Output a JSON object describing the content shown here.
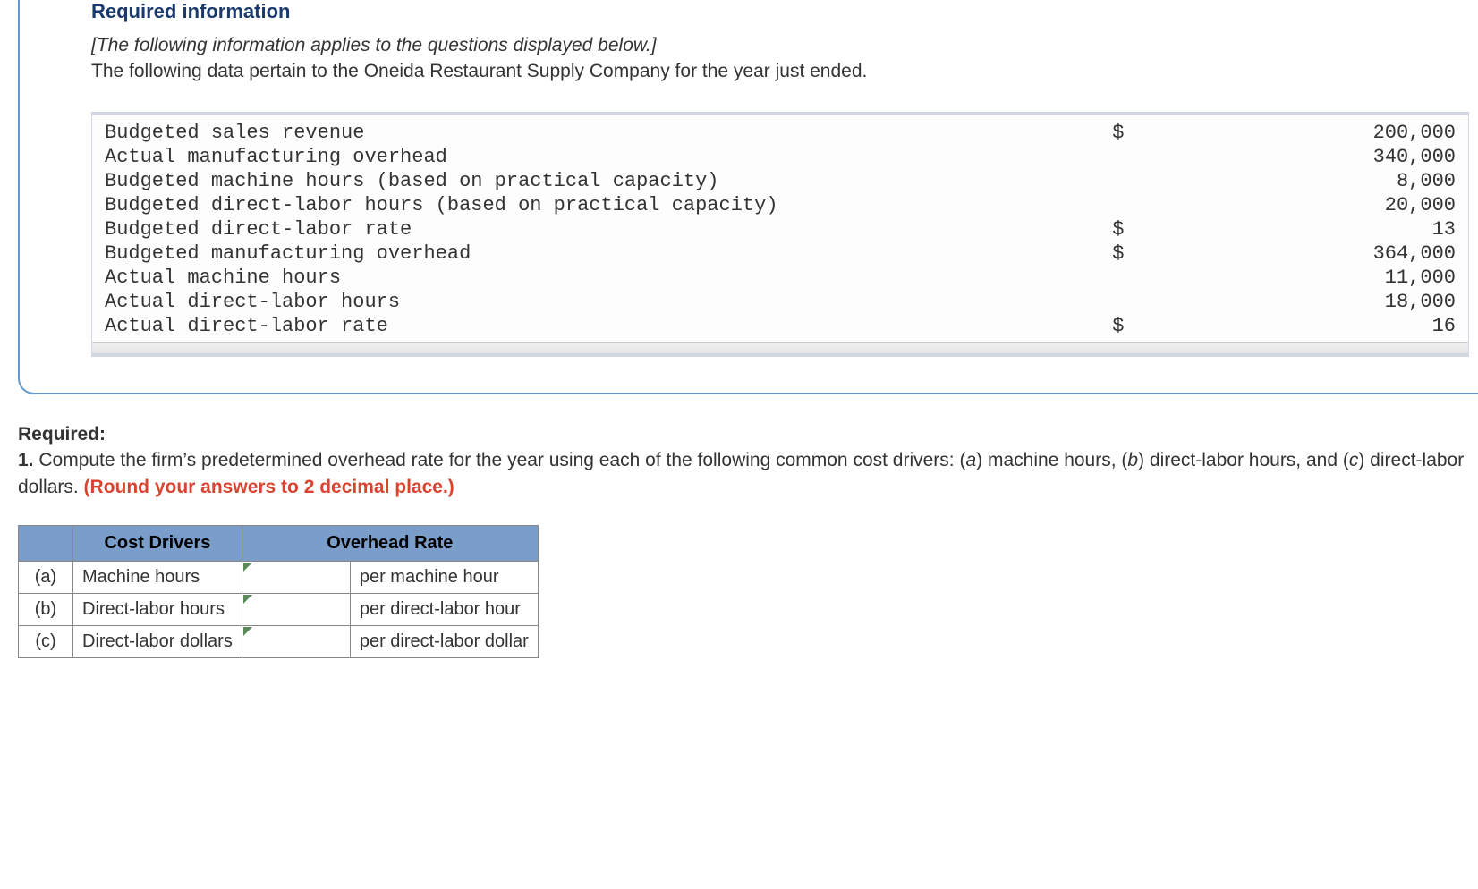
{
  "section_title": "Required information",
  "intro_italic": "[The following information applies to the questions displayed below.]",
  "intro_text": "The following data pertain to the Oneida Restaurant Supply Company for the year just ended.",
  "data_rows": [
    {
      "label": "Budgeted sales revenue",
      "sym": "$",
      "val": "200,000"
    },
    {
      "label": "Actual manufacturing overhead",
      "sym": "",
      "val": "340,000"
    },
    {
      "label": "Budgeted machine hours (based on practical capacity)",
      "sym": "",
      "val": "8,000"
    },
    {
      "label": "Budgeted direct-labor hours (based on practical capacity)",
      "sym": "",
      "val": "20,000"
    },
    {
      "label": "Budgeted direct-labor rate",
      "sym": "$",
      "val": "13"
    },
    {
      "label": "Budgeted manufacturing overhead",
      "sym": "$",
      "val": "364,000"
    },
    {
      "label": "Actual machine hours",
      "sym": "",
      "val": "11,000"
    },
    {
      "label": "Actual direct-labor hours",
      "sym": "",
      "val": "18,000"
    },
    {
      "label": "Actual direct-labor rate",
      "sym": "$",
      "val": "16"
    }
  ],
  "required_label": "Required:",
  "required_q1_num": "1.",
  "required_q1_a": " Compute the firm’s predetermined overhead rate for the year using each of the following common cost drivers: (",
  "required_q1_b": ") machine hours, (",
  "required_q1_c": ") direct-labor hours, and (",
  "required_q1_d": ") direct-labor dollars. ",
  "ital_a": "a",
  "ital_b": "b",
  "ital_c": "c",
  "round_note": "(Round your answers to 2 decimal place.)",
  "table": {
    "header1": "Cost Drivers",
    "header2": "Overhead Rate",
    "rows": [
      {
        "letter": "(a)",
        "driver": "Machine hours",
        "unit": "per machine hour"
      },
      {
        "letter": "(b)",
        "driver": "Direct-labor hours",
        "unit": "per direct-labor hour"
      },
      {
        "letter": "(c)",
        "driver": "Direct-labor dollars",
        "unit": "per direct-labor dollar"
      }
    ]
  }
}
